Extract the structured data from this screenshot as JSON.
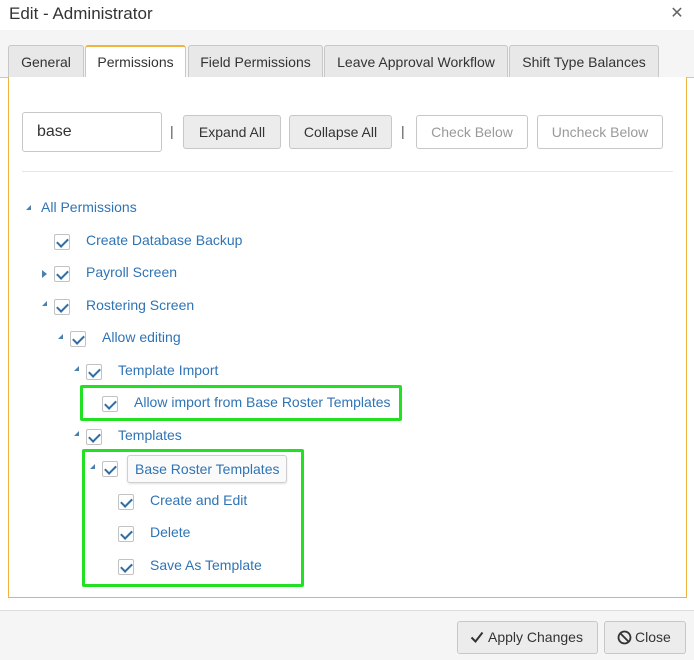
{
  "dialog": {
    "title": "Edit - Administrator"
  },
  "tabs": [
    {
      "label": "General",
      "active": false
    },
    {
      "label": "Permissions",
      "active": true
    },
    {
      "label": "Field Permissions",
      "active": false
    },
    {
      "label": "Leave Approval Workflow",
      "active": false
    },
    {
      "label": "Shift Type Balances",
      "active": false
    }
  ],
  "toolbar": {
    "search_value": "base",
    "separator": "|",
    "expand_all": "Expand All",
    "collapse_all": "Collapse All",
    "check_below": "Check Below",
    "uncheck_below": "Uncheck Below"
  },
  "tree": {
    "root": "All Permissions",
    "create_db_backup": "Create Database Backup",
    "payroll_screen": "Payroll Screen",
    "rostering_screen": "Rostering Screen",
    "allow_editing": "Allow editing",
    "template_import": "Template Import",
    "allow_import_base": "Allow import from Base Roster Templates",
    "templates": "Templates",
    "base_roster_templates": "Base Roster Templates",
    "create_and_edit": "Create and Edit",
    "delete": "Delete",
    "save_as_template": "Save As Template"
  },
  "footer": {
    "apply_changes": "Apply Changes",
    "close": "Close"
  },
  "colors": {
    "accent_tab": "#f0b240",
    "highlight": "#22e022",
    "link": "#2f74b5"
  }
}
